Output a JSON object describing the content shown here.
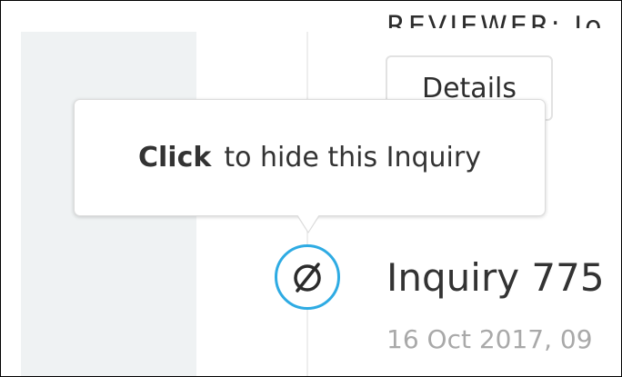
{
  "header_cut_text": "REVIEWER: Jo",
  "details_button": {
    "label": "Details"
  },
  "tooltip": {
    "bold": "Click",
    "text": "to hide this Inquiry"
  },
  "hide_toggle": {
    "icon": "eye-slash-icon",
    "color": "#2eabe3"
  },
  "inquiry": {
    "title": "Inquiry 775",
    "date": "16 Oct 2017, 09"
  },
  "colors": {
    "sidebar": "#eff2f3",
    "accent": "#2eabe3",
    "text": "#333333",
    "muted_text": "#a9a9a9"
  }
}
